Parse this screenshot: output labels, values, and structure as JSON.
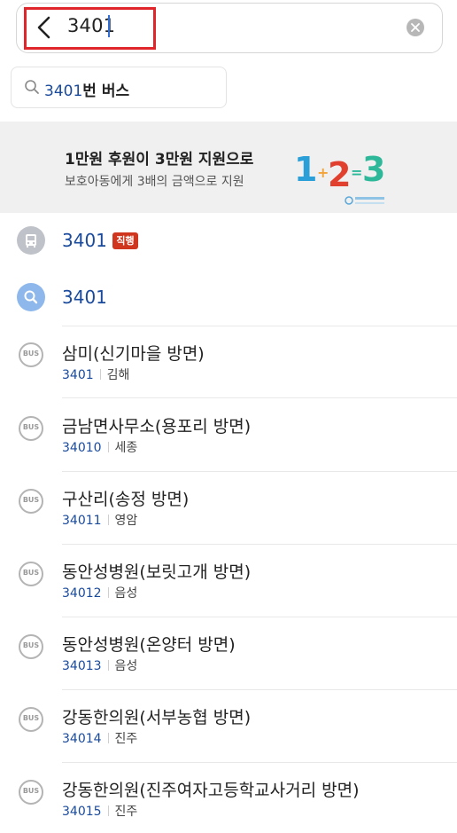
{
  "search": {
    "query": "3401"
  },
  "suggestion": {
    "number": "3401",
    "suffix": "번 버스"
  },
  "banner": {
    "title": "1만원 후원이 3만원 지원으로",
    "subtitle": "보호아동에게 3배의 금액으로 지원",
    "graphic_text": [
      "1",
      "+",
      "2",
      "=",
      "3"
    ],
    "colors": {
      "one": "#2a9fd8",
      "two": "#e2402e",
      "three": "#2eb89a",
      "ops": "#f2a33a"
    }
  },
  "route_result": {
    "number": "3401",
    "badge": "직행",
    "badge_color": "#d0361d"
  },
  "search_result": {
    "text": "3401"
  },
  "stops": [
    {
      "name": "삼미(신기마을 방면)",
      "code": "3401",
      "region": "김해"
    },
    {
      "name": "금남면사무소(용포리 방면)",
      "code": "34010",
      "region": "세종"
    },
    {
      "name": "구산리(송정 방면)",
      "code": "34011",
      "region": "영암"
    },
    {
      "name": "동안성병원(보릿고개 방면)",
      "code": "34012",
      "region": "음성"
    },
    {
      "name": "동안성병원(온양터 방면)",
      "code": "34013",
      "region": "음성"
    },
    {
      "name": "강동한의원(서부농협 방면)",
      "code": "34014",
      "region": "진주"
    },
    {
      "name": "강동한의원(진주여자고등학교사거리 방면)",
      "code": "34015",
      "region": "진주"
    }
  ],
  "icons": {
    "bus_stop_label": "BUS"
  },
  "accent_color": "#1a4a9c"
}
